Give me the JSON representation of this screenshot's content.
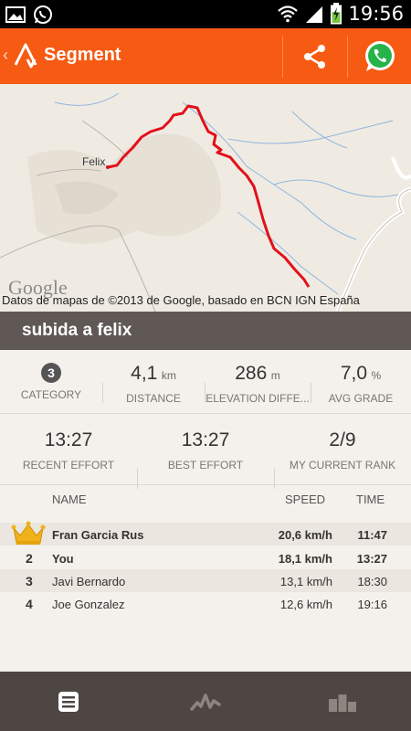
{
  "status_bar": {
    "time": "19:56",
    "icons": [
      "gallery-icon",
      "whatsapp-notification-icon",
      "wifi-icon",
      "signal-icon",
      "battery-charging-icon"
    ]
  },
  "action_bar": {
    "title": "Segment",
    "back_icon": "chevron-left-icon",
    "logo_icon": "strava-logo-icon",
    "share_icon": "share-icon",
    "whatsapp_icon": "whatsapp-icon"
  },
  "map": {
    "town_label": "Felix",
    "google_logo": "Google",
    "attribution": "Datos de mapas de ©2013 de Google, basado en BCN IGN España",
    "route_color": "#e3101a"
  },
  "segment": {
    "title": "subida a felix"
  },
  "stats": {
    "category": {
      "value": "3",
      "label": "CATEGORY"
    },
    "distance": {
      "value": "4,1",
      "unit": "km",
      "label": "DISTANCE"
    },
    "elevation": {
      "value": "286",
      "unit": "m",
      "label": "ELEVATION DIFFE..."
    },
    "avg_grade": {
      "value": "7,0",
      "unit": "%",
      "label": "AVG GRADE"
    },
    "recent_effort": {
      "value": "13:27",
      "label": "RECENT EFFORT"
    },
    "best_effort": {
      "value": "13:27",
      "label": "BEST EFFORT"
    },
    "current_rank": {
      "value": "2/9",
      "label": "MY CURRENT RANK"
    }
  },
  "leaderboard": {
    "headers": {
      "name": "NAME",
      "speed": "SPEED",
      "time": "TIME"
    },
    "rows": [
      {
        "rank": "",
        "name": "Fran Garcia Rus",
        "speed": "20,6 km/h",
        "time": "11:47"
      },
      {
        "rank": "2",
        "name": "You",
        "speed": "18,1 km/h",
        "time": "13:27"
      },
      {
        "rank": "3",
        "name": "Javi Bernardo",
        "speed": "13,1 km/h",
        "time": "18:30"
      },
      {
        "rank": "4",
        "name": "Joe Gonzalez",
        "speed": "12,6 km/h",
        "time": "19:16"
      }
    ],
    "leader_icon": "crown-icon"
  },
  "bottom_nav": {
    "items": [
      "document-icon",
      "activity-icon",
      "leaderboard-icon"
    ]
  },
  "colors": {
    "accent": "#f75a12",
    "title_bar": "#5f5855",
    "nav": "#4d4643"
  }
}
